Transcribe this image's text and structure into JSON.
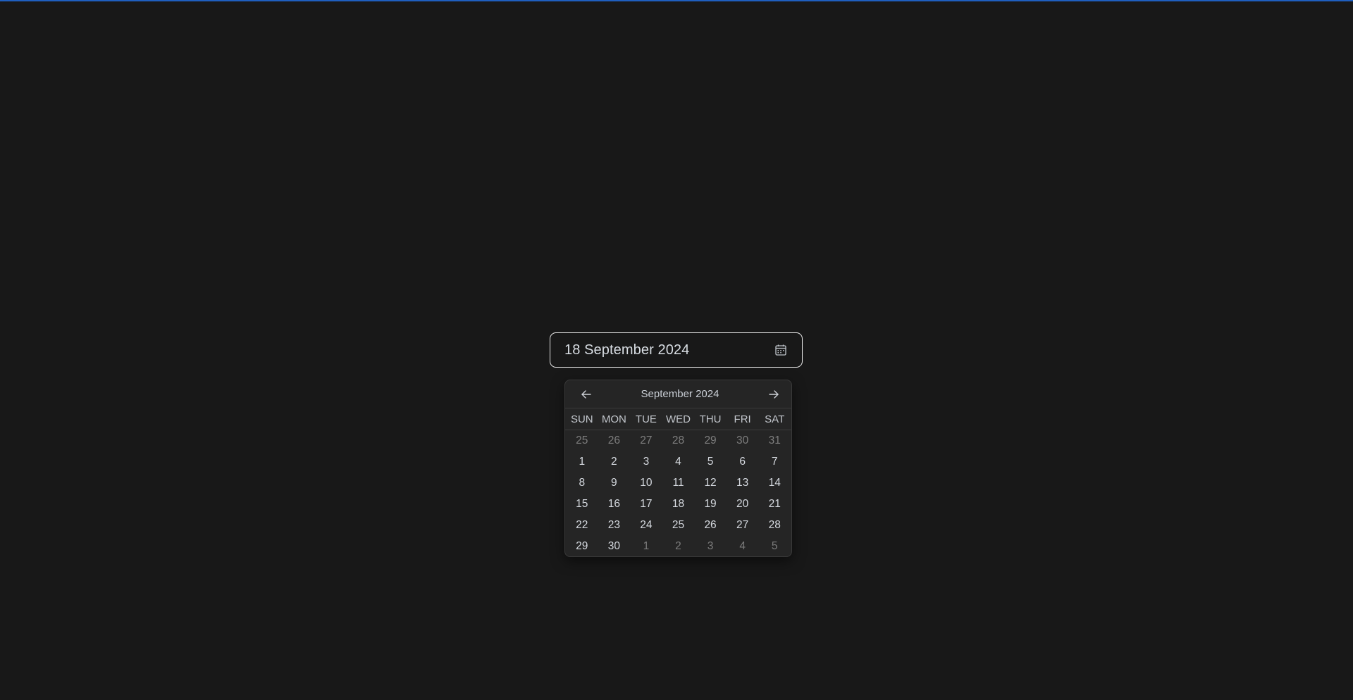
{
  "accent_color": "#1f5fbf",
  "date_picker": {
    "value": "18 September 2024",
    "icon": "calendar-icon"
  },
  "calendar": {
    "month_label": "September 2024",
    "prev_icon": "arrow-left-icon",
    "next_icon": "arrow-right-icon",
    "weekdays": [
      "SUN",
      "MON",
      "TUE",
      "WED",
      "THU",
      "FRI",
      "SAT"
    ],
    "weeks": [
      [
        {
          "d": "25",
          "out": true
        },
        {
          "d": "26",
          "out": true
        },
        {
          "d": "27",
          "out": true
        },
        {
          "d": "28",
          "out": true
        },
        {
          "d": "29",
          "out": true
        },
        {
          "d": "30",
          "out": true
        },
        {
          "d": "31",
          "out": true
        }
      ],
      [
        {
          "d": "1",
          "out": false
        },
        {
          "d": "2",
          "out": false
        },
        {
          "d": "3",
          "out": false
        },
        {
          "d": "4",
          "out": false
        },
        {
          "d": "5",
          "out": false
        },
        {
          "d": "6",
          "out": false
        },
        {
          "d": "7",
          "out": false
        }
      ],
      [
        {
          "d": "8",
          "out": false
        },
        {
          "d": "9",
          "out": false
        },
        {
          "d": "10",
          "out": false
        },
        {
          "d": "11",
          "out": false
        },
        {
          "d": "12",
          "out": false
        },
        {
          "d": "13",
          "out": false
        },
        {
          "d": "14",
          "out": false
        }
      ],
      [
        {
          "d": "15",
          "out": false
        },
        {
          "d": "16",
          "out": false
        },
        {
          "d": "17",
          "out": false
        },
        {
          "d": "18",
          "out": false
        },
        {
          "d": "19",
          "out": false
        },
        {
          "d": "20",
          "out": false
        },
        {
          "d": "21",
          "out": false
        }
      ],
      [
        {
          "d": "22",
          "out": false
        },
        {
          "d": "23",
          "out": false
        },
        {
          "d": "24",
          "out": false
        },
        {
          "d": "25",
          "out": false
        },
        {
          "d": "26",
          "out": false
        },
        {
          "d": "27",
          "out": false
        },
        {
          "d": "28",
          "out": false
        }
      ],
      [
        {
          "d": "29",
          "out": false
        },
        {
          "d": "30",
          "out": false
        },
        {
          "d": "1",
          "out": true
        },
        {
          "d": "2",
          "out": true
        },
        {
          "d": "3",
          "out": true
        },
        {
          "d": "4",
          "out": true
        },
        {
          "d": "5",
          "out": true
        }
      ]
    ]
  }
}
